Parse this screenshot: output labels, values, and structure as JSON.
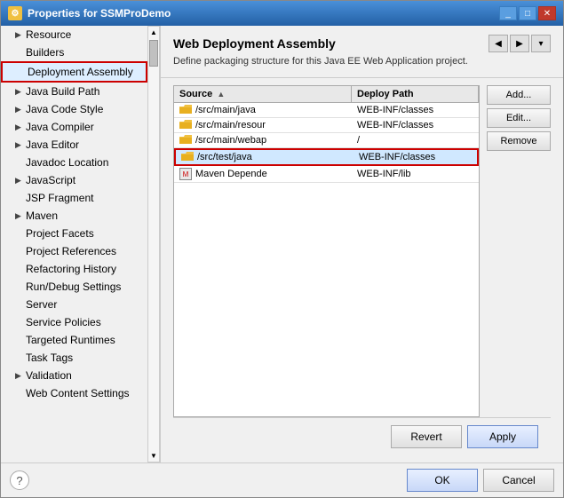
{
  "dialog": {
    "title": "Properties for SSMProDemo",
    "icon": "P"
  },
  "left_panel": {
    "items": [
      {
        "id": "resource",
        "label": "Resource",
        "has_arrow": true,
        "selected": false,
        "highlighted": false
      },
      {
        "id": "builders",
        "label": "Builders",
        "has_arrow": false,
        "selected": false,
        "highlighted": false
      },
      {
        "id": "deployment-assembly",
        "label": "Deployment Assembly",
        "has_arrow": false,
        "selected": false,
        "highlighted": true
      },
      {
        "id": "java-build-path",
        "label": "Java Build Path",
        "has_arrow": true,
        "selected": false,
        "highlighted": false
      },
      {
        "id": "java-code-style",
        "label": "Java Code Style",
        "has_arrow": true,
        "selected": false,
        "highlighted": false
      },
      {
        "id": "java-compiler",
        "label": "Java Compiler",
        "has_arrow": true,
        "selected": false,
        "highlighted": false
      },
      {
        "id": "java-editor",
        "label": "Java Editor",
        "has_arrow": true,
        "selected": false,
        "highlighted": false
      },
      {
        "id": "javadoc-location",
        "label": "Javadoc Location",
        "has_arrow": false,
        "selected": false,
        "highlighted": false
      },
      {
        "id": "javascript",
        "label": "JavaScript",
        "has_arrow": true,
        "selected": false,
        "highlighted": false
      },
      {
        "id": "jsp-fragment",
        "label": "JSP Fragment",
        "has_arrow": false,
        "selected": false,
        "highlighted": false
      },
      {
        "id": "maven",
        "label": "Maven",
        "has_arrow": true,
        "selected": false,
        "highlighted": false
      },
      {
        "id": "project-facets",
        "label": "Project Facets",
        "has_arrow": false,
        "selected": false,
        "highlighted": false
      },
      {
        "id": "project-references",
        "label": "Project References",
        "has_arrow": false,
        "selected": false,
        "highlighted": false
      },
      {
        "id": "refactoring-history",
        "label": "Refactoring History",
        "has_arrow": false,
        "selected": false,
        "highlighted": false
      },
      {
        "id": "run-debug-settings",
        "label": "Run/Debug Settings",
        "has_arrow": false,
        "selected": false,
        "highlighted": false
      },
      {
        "id": "server",
        "label": "Server",
        "has_arrow": false,
        "selected": false,
        "highlighted": false
      },
      {
        "id": "service-policies",
        "label": "Service Policies",
        "has_arrow": false,
        "selected": false,
        "highlighted": false
      },
      {
        "id": "targeted-runtimes",
        "label": "Targeted Runtimes",
        "has_arrow": false,
        "selected": false,
        "highlighted": false
      },
      {
        "id": "task-tags",
        "label": "Task Tags",
        "has_arrow": false,
        "selected": false,
        "highlighted": false
      },
      {
        "id": "validation",
        "label": "Validation",
        "has_arrow": true,
        "selected": false,
        "highlighted": false
      },
      {
        "id": "web-content-settings",
        "label": "Web Content Settings",
        "has_arrow": false,
        "selected": false,
        "highlighted": false
      }
    ]
  },
  "right_panel": {
    "title": "Web Deployment Assembly",
    "description": "Define packaging structure for this Java EE Web Application project.",
    "table": {
      "col_source": "Source",
      "col_deploy": "Deploy Path",
      "rows": [
        {
          "source": "/src/main/java",
          "deploy": "WEB-INF/classes",
          "highlighted": false,
          "type": "folder"
        },
        {
          "source": "/src/main/resour",
          "deploy": "WEB-INF/classes",
          "highlighted": false,
          "type": "folder"
        },
        {
          "source": "/src/main/webap",
          "deploy": "/",
          "highlighted": false,
          "type": "folder"
        },
        {
          "source": "/src/test/java",
          "deploy": "WEB-INF/classes",
          "highlighted": true,
          "type": "folder"
        },
        {
          "source": "Maven Depende",
          "deploy": "WEB-INF/lib",
          "highlighted": false,
          "type": "maven"
        }
      ]
    },
    "buttons": {
      "add": "Add...",
      "edit": "Edit...",
      "remove": "Remove"
    }
  },
  "footer": {
    "revert": "Revert",
    "apply": "Apply",
    "ok": "OK",
    "cancel": "Cancel",
    "help_symbol": "?"
  }
}
